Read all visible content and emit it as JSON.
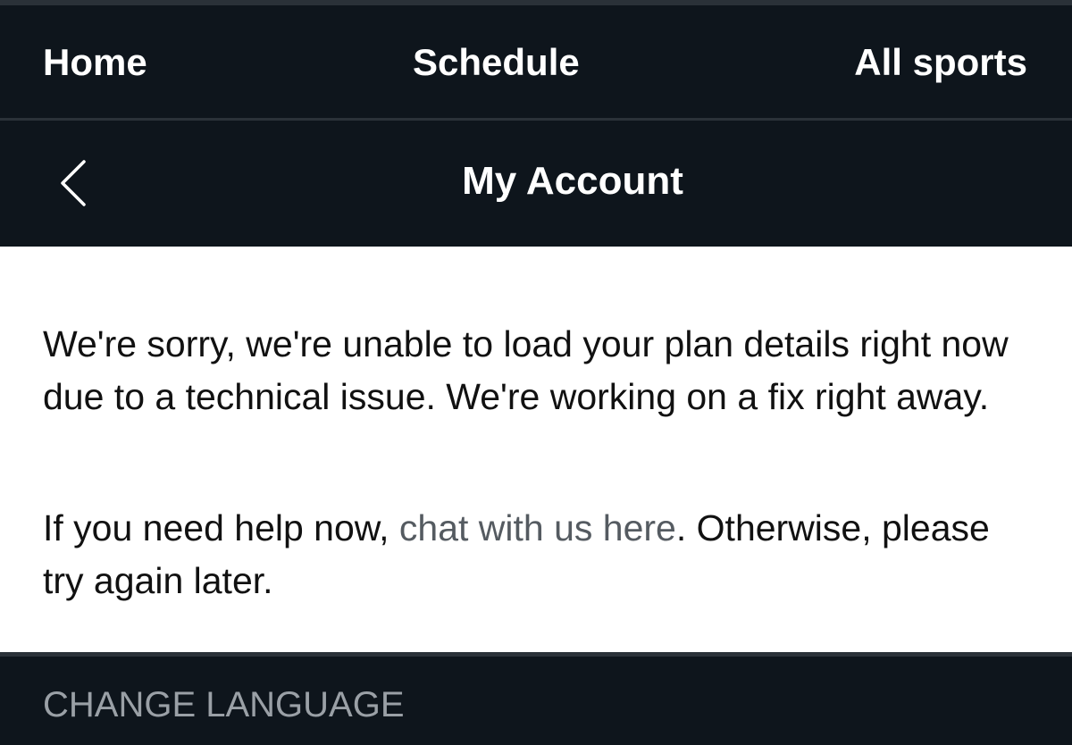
{
  "nav": {
    "home": "Home",
    "schedule": "Schedule",
    "all_sports": "All sports"
  },
  "header": {
    "back_icon": "chevron-left-icon",
    "title": "My Account"
  },
  "content": {
    "error_message": "We're sorry, we're unable to load your plan details right now due to a technical issue. We're working on a fix right away.",
    "help_prefix": "If you need help now, ",
    "help_link": "chat with us here",
    "help_suffix": ". Otherwise, please try again later."
  },
  "footer": {
    "change_language": "CHANGE LANGUAGE"
  },
  "colors": {
    "background_dark": "#0e151c",
    "divider": "#2b3239",
    "content_background": "#ffffff",
    "body_text": "#111111",
    "link_text": "#555b61",
    "footer_text": "#9aa0a6"
  }
}
